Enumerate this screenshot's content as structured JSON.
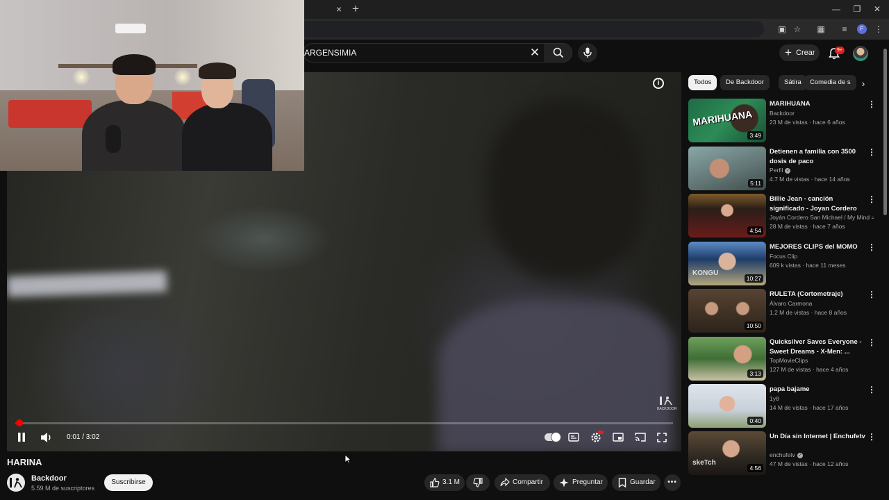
{
  "browser": {
    "tab_close": "×",
    "new_tab": "+",
    "profile_initial": "F"
  },
  "header": {
    "search_value": "ARGENSIMIA",
    "create_label": "Crear",
    "notifications_badge": "9+"
  },
  "player": {
    "time_display": "0:01 / 3:02",
    "progress_fraction": 0.006,
    "watermark": "BACKDOOR"
  },
  "video": {
    "title": "HARINA",
    "channel": "Backdoor",
    "subscribers": "5.59 M de suscriptores",
    "subscribe_label": "Suscribirse",
    "likes": "3.1 M",
    "share_label": "Compartir",
    "ask_label": "Preguntar",
    "save_label": "Guardar"
  },
  "chips": [
    "Todos",
    "De Backdoor",
    "Sátira",
    "Comedia de s"
  ],
  "recommendations": [
    {
      "title": "MARIHUANA",
      "channel": "Backdoor",
      "meta": "23 M de vistas · hace 6 años",
      "duration": "3:49",
      "verified": false,
      "thumb_text": "MARIHUANA"
    },
    {
      "title": "Detienen a familia con 3500 dosis de paco",
      "channel": "Perfil",
      "meta": "4.7 M de vistas · hace 14 años",
      "duration": "5:11",
      "verified": true,
      "thumb_text": ""
    },
    {
      "title": "Billie Jean - canción significado - Joyan Cordero",
      "channel": "Joyán Cordero San Michael / My Mind = ...",
      "meta": "28 M de vistas · hace 7 años",
      "duration": "4:54",
      "verified": false,
      "thumb_text": ""
    },
    {
      "title": "MEJORES CLIPS del MOMO",
      "channel": "Focus Clip",
      "meta": "609 k vistas · hace 11 meses",
      "duration": "10:27",
      "verified": false,
      "thumb_text": "KONGU"
    },
    {
      "title": "RULETA (Cortometraje)",
      "channel": "Álvaro Carmona",
      "meta": "1.2 M de vistas · hace 8 años",
      "duration": "10:50",
      "verified": false,
      "thumb_text": ""
    },
    {
      "title": "Quicksilver Saves Everyone - Sweet Dreams - X-Men: ...",
      "channel": "TopMovieClips",
      "meta": "127 M de vistas · hace 4 años",
      "duration": "3:13",
      "verified": false,
      "thumb_text": ""
    },
    {
      "title": "papa bajame",
      "channel": "1y8",
      "meta": "14 M de vistas · hace 17 años",
      "duration": "0:40",
      "verified": false,
      "thumb_text": ""
    },
    {
      "title": "Un Día sin Internet | Enchufetv",
      "channel": "enchufetv",
      "meta": "47 M de vistas · hace 12 años",
      "duration": "4:56",
      "verified": true,
      "thumb_text": "skeTch"
    }
  ],
  "colors": {
    "background": "#0f0f0f",
    "accent": "#ff0000",
    "chip_active": "#f1f1f1"
  }
}
